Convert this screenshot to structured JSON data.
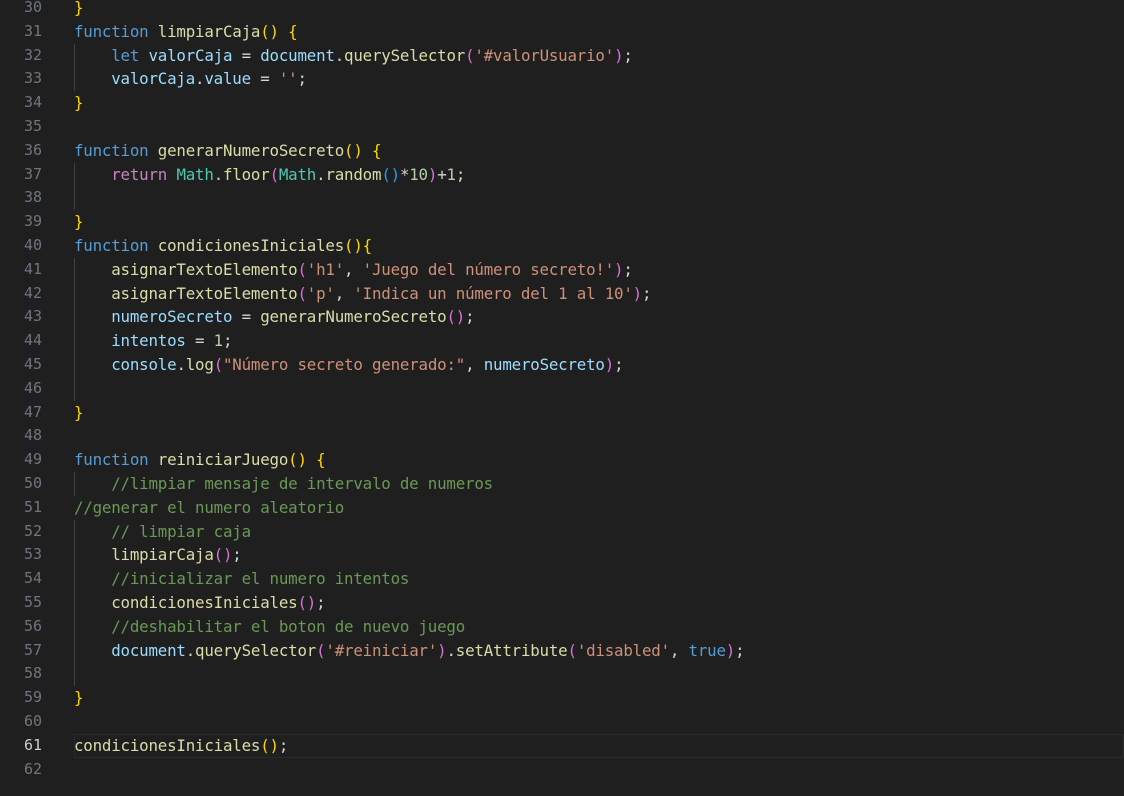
{
  "editor": {
    "current_line": 61,
    "colors": {
      "background": "#1f1f1f",
      "line_number": "#6e7681",
      "keyword": "#569cd6",
      "function": "#dcdcaa",
      "variable": "#9cdcfe",
      "class": "#4ec9b0",
      "string": "#ce9178",
      "number": "#b5cea8",
      "comment": "#6a9955",
      "bracket1": "#ffd700",
      "bracket2": "#da70d6",
      "bracket3": "#179fff"
    },
    "lines": [
      {
        "n": "30",
        "guide": false,
        "tokens": [
          [
            "p1",
            "}"
          ]
        ]
      },
      {
        "n": "31",
        "guide": false,
        "tokens": [
          [
            "kw",
            "function"
          ],
          [
            "plain",
            " "
          ],
          [
            "fn",
            "limpiarCaja"
          ],
          [
            "p1",
            "()"
          ],
          [
            "plain",
            " "
          ],
          [
            "p1",
            "{"
          ]
        ]
      },
      {
        "n": "32",
        "guide": true,
        "tokens": [
          [
            "plain",
            "    "
          ],
          [
            "kw",
            "let"
          ],
          [
            "plain",
            " "
          ],
          [
            "var",
            "valorCaja"
          ],
          [
            "plain",
            " = "
          ],
          [
            "var",
            "document"
          ],
          [
            "plain",
            "."
          ],
          [
            "fn",
            "querySelector"
          ],
          [
            "p2",
            "("
          ],
          [
            "str",
            "'#valorUsuario'"
          ],
          [
            "p2",
            ")"
          ],
          [
            "plain",
            ";"
          ]
        ]
      },
      {
        "n": "33",
        "guide": true,
        "tokens": [
          [
            "plain",
            "    "
          ],
          [
            "var",
            "valorCaja"
          ],
          [
            "plain",
            "."
          ],
          [
            "var",
            "value"
          ],
          [
            "plain",
            " = "
          ],
          [
            "str",
            "''"
          ],
          [
            "plain",
            ";"
          ]
        ]
      },
      {
        "n": "34",
        "guide": false,
        "tokens": [
          [
            "p1",
            "}"
          ]
        ]
      },
      {
        "n": "35",
        "guide": false,
        "tokens": []
      },
      {
        "n": "36",
        "guide": false,
        "tokens": [
          [
            "kw",
            "function"
          ],
          [
            "plain",
            " "
          ],
          [
            "fn",
            "generarNumeroSecreto"
          ],
          [
            "p1",
            "()"
          ],
          [
            "plain",
            " "
          ],
          [
            "p1",
            "{"
          ]
        ]
      },
      {
        "n": "37",
        "guide": true,
        "tokens": [
          [
            "plain",
            "    "
          ],
          [
            "ctrl",
            "return"
          ],
          [
            "plain",
            " "
          ],
          [
            "cls",
            "Math"
          ],
          [
            "plain",
            "."
          ],
          [
            "fn",
            "floor"
          ],
          [
            "p2",
            "("
          ],
          [
            "cls",
            "Math"
          ],
          [
            "plain",
            "."
          ],
          [
            "fn",
            "random"
          ],
          [
            "p3",
            "()"
          ],
          [
            "plain",
            "*"
          ],
          [
            "num",
            "10"
          ],
          [
            "p2",
            ")"
          ],
          [
            "plain",
            "+"
          ],
          [
            "num",
            "1"
          ],
          [
            "plain",
            ";"
          ]
        ]
      },
      {
        "n": "38",
        "guide": true,
        "tokens": []
      },
      {
        "n": "39",
        "guide": false,
        "tokens": [
          [
            "p1",
            "}"
          ]
        ]
      },
      {
        "n": "40",
        "guide": false,
        "tokens": [
          [
            "kw",
            "function"
          ],
          [
            "plain",
            " "
          ],
          [
            "fn",
            "condicionesIniciales"
          ],
          [
            "p1",
            "()"
          ],
          [
            "p1",
            "{"
          ]
        ]
      },
      {
        "n": "41",
        "guide": true,
        "tokens": [
          [
            "plain",
            "    "
          ],
          [
            "fn",
            "asignarTextoElemento"
          ],
          [
            "p2",
            "("
          ],
          [
            "str",
            "'h1'"
          ],
          [
            "plain",
            ", "
          ],
          [
            "str",
            "'Juego del número secreto!'"
          ],
          [
            "p2",
            ")"
          ],
          [
            "plain",
            ";"
          ]
        ]
      },
      {
        "n": "42",
        "guide": true,
        "tokens": [
          [
            "plain",
            "    "
          ],
          [
            "fn",
            "asignarTextoElemento"
          ],
          [
            "p2",
            "("
          ],
          [
            "str",
            "'p'"
          ],
          [
            "plain",
            ", "
          ],
          [
            "str",
            "'Indica un número del 1 al 10'"
          ],
          [
            "p2",
            ")"
          ],
          [
            "plain",
            ";"
          ]
        ]
      },
      {
        "n": "43",
        "guide": true,
        "tokens": [
          [
            "plain",
            "    "
          ],
          [
            "var",
            "numeroSecreto"
          ],
          [
            "plain",
            " = "
          ],
          [
            "fn",
            "generarNumeroSecreto"
          ],
          [
            "p2",
            "()"
          ],
          [
            "plain",
            ";"
          ]
        ]
      },
      {
        "n": "44",
        "guide": true,
        "tokens": [
          [
            "plain",
            "    "
          ],
          [
            "var",
            "intentos"
          ],
          [
            "plain",
            " = "
          ],
          [
            "num",
            "1"
          ],
          [
            "plain",
            ";"
          ]
        ]
      },
      {
        "n": "45",
        "guide": true,
        "tokens": [
          [
            "plain",
            "    "
          ],
          [
            "var",
            "console"
          ],
          [
            "plain",
            "."
          ],
          [
            "fn",
            "log"
          ],
          [
            "p2",
            "("
          ],
          [
            "str",
            "\"Número secreto generado:\""
          ],
          [
            "plain",
            ", "
          ],
          [
            "var",
            "numeroSecreto"
          ],
          [
            "p2",
            ")"
          ],
          [
            "plain",
            ";"
          ]
        ]
      },
      {
        "n": "46",
        "guide": true,
        "tokens": []
      },
      {
        "n": "47",
        "guide": false,
        "tokens": [
          [
            "p1",
            "}"
          ]
        ]
      },
      {
        "n": "48",
        "guide": false,
        "tokens": []
      },
      {
        "n": "49",
        "guide": false,
        "tokens": [
          [
            "kw",
            "function"
          ],
          [
            "plain",
            " "
          ],
          [
            "fn",
            "reiniciarJuego"
          ],
          [
            "p1",
            "()"
          ],
          [
            "plain",
            " "
          ],
          [
            "p1",
            "{"
          ]
        ]
      },
      {
        "n": "50",
        "guide": true,
        "tokens": [
          [
            "plain",
            "    "
          ],
          [
            "cmt",
            "//limpiar mensaje de intervalo de numeros"
          ]
        ]
      },
      {
        "n": "51",
        "guide": false,
        "tokens": [
          [
            "cmt",
            "//generar el numero aleatorio"
          ]
        ]
      },
      {
        "n": "52",
        "guide": true,
        "tokens": [
          [
            "plain",
            "    "
          ],
          [
            "cmt",
            "// limpiar caja"
          ]
        ]
      },
      {
        "n": "53",
        "guide": true,
        "tokens": [
          [
            "plain",
            "    "
          ],
          [
            "fn",
            "limpiarCaja"
          ],
          [
            "p2",
            "()"
          ],
          [
            "plain",
            ";"
          ]
        ]
      },
      {
        "n": "54",
        "guide": true,
        "tokens": [
          [
            "plain",
            "    "
          ],
          [
            "cmt",
            "//inicializar el numero intentos"
          ]
        ]
      },
      {
        "n": "55",
        "guide": true,
        "tokens": [
          [
            "plain",
            "    "
          ],
          [
            "fn",
            "condicionesIniciales"
          ],
          [
            "p2",
            "()"
          ],
          [
            "plain",
            ";"
          ]
        ]
      },
      {
        "n": "56",
        "guide": true,
        "tokens": [
          [
            "plain",
            "    "
          ],
          [
            "cmt",
            "//deshabilitar el boton de nuevo juego"
          ]
        ]
      },
      {
        "n": "57",
        "guide": true,
        "tokens": [
          [
            "plain",
            "    "
          ],
          [
            "var",
            "document"
          ],
          [
            "plain",
            "."
          ],
          [
            "fn",
            "querySelector"
          ],
          [
            "p2",
            "("
          ],
          [
            "str",
            "'#reiniciar'"
          ],
          [
            "p2",
            ")"
          ],
          [
            "plain",
            "."
          ],
          [
            "fn",
            "setAttribute"
          ],
          [
            "p2",
            "("
          ],
          [
            "str",
            "'disabled'"
          ],
          [
            "plain",
            ", "
          ],
          [
            "kw",
            "true"
          ],
          [
            "p2",
            ")"
          ],
          [
            "plain",
            ";"
          ]
        ]
      },
      {
        "n": "58",
        "guide": true,
        "tokens": []
      },
      {
        "n": "59",
        "guide": false,
        "tokens": [
          [
            "p1",
            "}"
          ]
        ]
      },
      {
        "n": "60",
        "guide": false,
        "tokens": []
      },
      {
        "n": "61",
        "guide": false,
        "tokens": [
          [
            "fn",
            "condicionesIniciales"
          ],
          [
            "p1",
            "()"
          ],
          [
            "plain",
            ";"
          ]
        ]
      },
      {
        "n": "62",
        "guide": false,
        "tokens": []
      }
    ]
  }
}
